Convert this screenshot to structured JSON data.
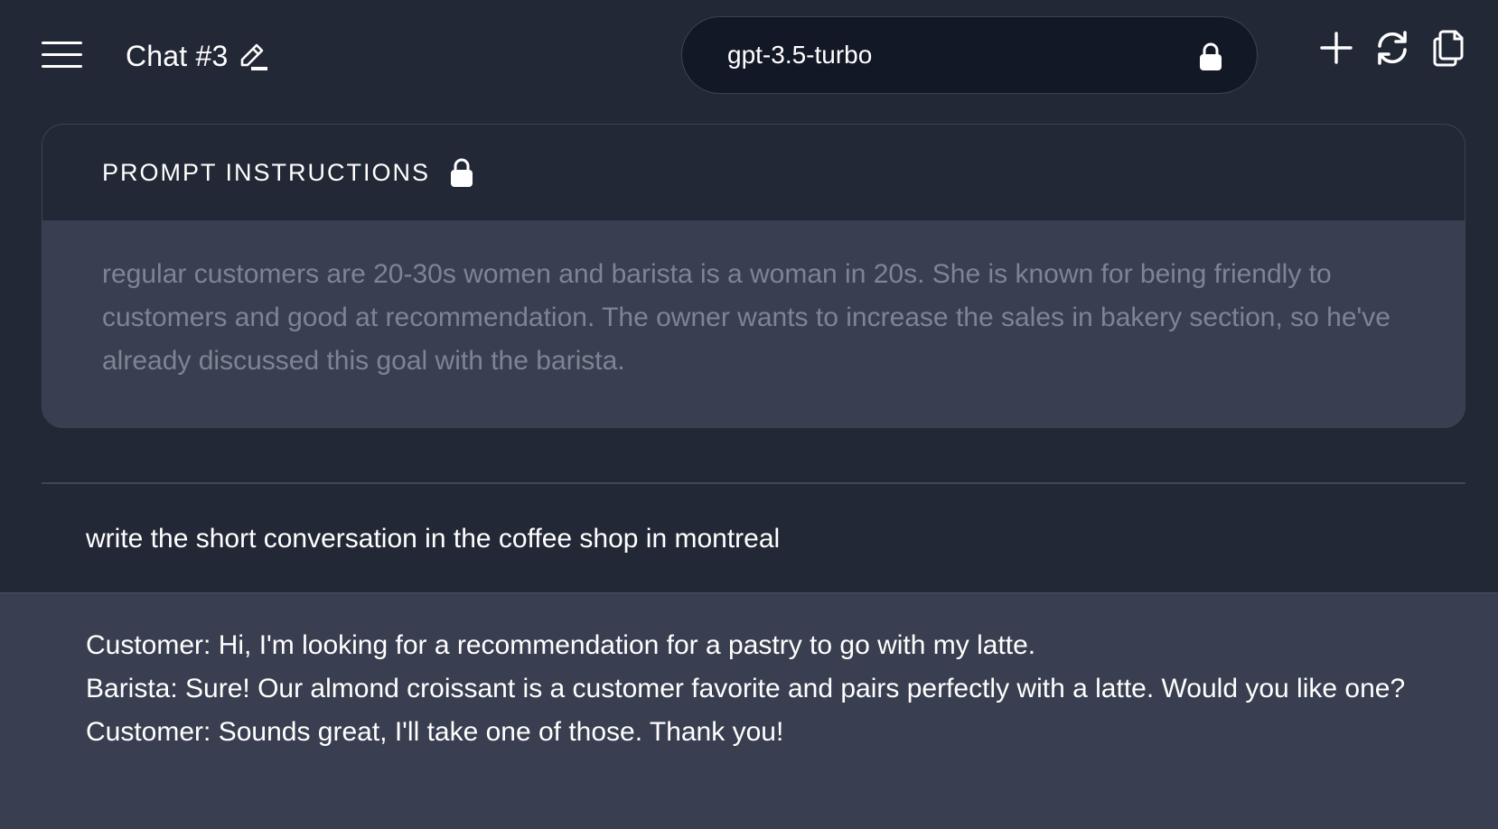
{
  "header": {
    "chat_title": "Chat #3",
    "model": "gpt-3.5-turbo"
  },
  "prompt": {
    "title": "PROMPT INSTRUCTIONS",
    "text": "regular customers are 20-30s women and barista is a woman in 20s. She is known for being friendly to customers and good at recommendation. The owner wants to increase the sales in bakery section, so he've already discussed this goal with the barista."
  },
  "messages": {
    "user": "write the short conversation in the coffee shop in montreal",
    "assistant": [
      "Customer: Hi, I'm looking for a recommendation for a pastry to go with my latte.",
      "Barista: Sure! Our almond croissant is a customer favorite and pairs perfectly with a latte. Would you like one?",
      "Customer: Sounds great, I'll take one of those. Thank you!"
    ]
  },
  "icons": {
    "menu": "hamburger-menu-icon",
    "edit": "pencil-edit-icon",
    "model_lock": "lock-icon",
    "new": "plus-icon",
    "refresh": "refresh-icon",
    "copy": "copy-icon",
    "prompt_lock": "lock-icon"
  },
  "colors": {
    "background": "#232836",
    "card_body": "#393f50",
    "muted_text": "#7e8494",
    "pill_background": "#131826"
  }
}
